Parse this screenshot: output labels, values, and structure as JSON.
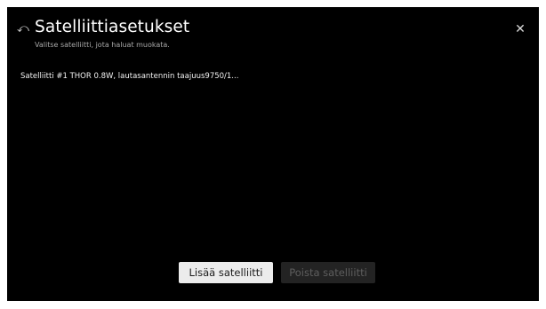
{
  "header": {
    "title": "Satelliittiasetukset",
    "subtitle": "Valitse satelliitti, jota haluat muokata.",
    "back_glyph": "⤺",
    "close_glyph": "✕"
  },
  "satellites": {
    "items": [
      {
        "label": "Satelliitti #1 THOR 0.8W, lautasantennin taajuus9750/1..."
      }
    ]
  },
  "buttons": {
    "add_label": "Lisää satelliitti",
    "remove_label": "Poista satelliitti",
    "remove_enabled": false
  },
  "colors": {
    "background": "#000000",
    "text": "#ffffff",
    "subtitle_text": "#a9a9a9",
    "button_focused_bg": "#ececec",
    "button_disabled_bg": "#232323",
    "button_disabled_text": "#5e5e5e"
  },
  "icons": {
    "back": "back-arrow-icon",
    "close": "close-icon"
  }
}
